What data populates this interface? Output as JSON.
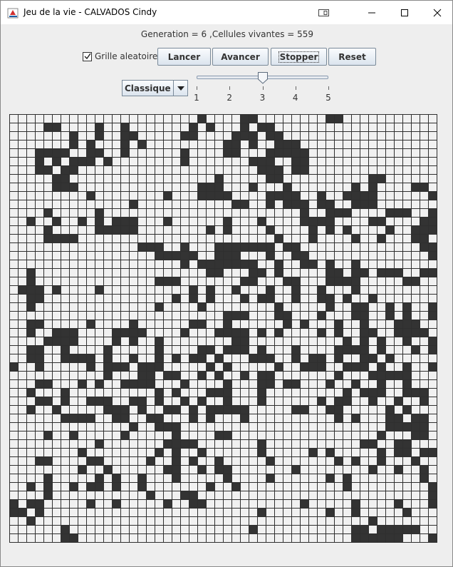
{
  "window": {
    "title": "Jeu de la vie - CALVADOS Cindy",
    "app_icon": "java-cup-icon",
    "controls": [
      "restore-extra-icon",
      "minimize-icon",
      "maximize-icon",
      "close-icon"
    ]
  },
  "status_text": "Generation = 6 ,Cellules vivantes = 559",
  "controls": {
    "checkbox_label": "Grille aleatoire",
    "checkbox_checked": true,
    "buttons": {
      "lancer": "Lancer",
      "avancer": "Avancer",
      "stopper": "Stopper",
      "reset": "Reset"
    },
    "mode_select_value": "Classique",
    "speed_slider": {
      "min": 1,
      "max": 5,
      "value": 3,
      "tick_labels": [
        "1",
        "2",
        "3",
        "4",
        "5"
      ]
    }
  },
  "colors": {
    "alive": "#333333",
    "dead": "#f1f1f1",
    "grid_line": "#2f2f2f"
  },
  "grid": {
    "rows": 50,
    "cols": 50,
    "cells": [
      "......................*....**........**...........",
      "....**....*..*.......*.*...*.**...................",
      ".......*..*..**.....**....***.**..................",
      ".......*.*...*.*.........**.*..***................",
      "...****..**..*......*....**...*****...............",
      "...*.*.***.*........*.......***..**...............",
      "...**.**.....................***.**...............",
      ".....**.................*.....**..........**......",
      ".....***..............***...*...*.......*.*....**.",
      ".........*........*...****....****..*..****......*",
      "..............*...........**..*.***.**..***.......",
      "....*.....*.......................*..***....***..*",
      "..*..*..*.*.***...*......*...*....****....**....**",
      "....*.....*****........*.*....*....*.*.*....*..***",
      "....****.......................*...*....*..*...**.",
      "...............***..*...*******.**..............**",
      ".................*****..***...*..**..............**",
      "....................*.*******..*..**.*..*.........",
      "..*....................**...**.*.....**.**.***..***",
      "..*..............***.......**...**...****.....**..",
      ".***.*....*..........*.*..*...*..*..*...*.........",
      "..**...............*.*.*...*.**..*..**.*..*.......",
      "..*..............*....*........*.....*..**..*.*..*",
      ".........................***...**...*...**..*.*..*",
      "..**.....*....*......**..*......*.*...*..*...***..",
      "..*..***....****....*...****.*.*....*.*..**..****.",
      "....****....*.*..*........**...........*.*.*..*..*",
      "..**..*....*.....*....**.***.*...*....****.*...*.*",
      "..**..****.*..*..*.*.**.*...***..*.**.*..**.*.....",
      "*..*.....*.***.***.....*.*.....*..***..***.*..*..*",
      "...........*...**.**..*.*..*.**.......*...*****...",
      "...**...*.*..****...*....*...**.**...*..*..*..*...",
      "..*...*..........*.*...***...*.........*.***..***.",
      "...**.*..***..**.*..*.*..*...*......*.**..*..*..*.",
      "..*..*.....***.*..**.*.*****.....**..**.....*.*...",
      "......****..**..**...*.*...*..........*.*...**.**.",
      "..............*..***........................*****..",
      "....*..*.....*.....*....**.................*...**.",
      "..........*.......****.......*...........**..**...",
      "........*........*.*..*......*.....*.*.....*.**.**",
      "...**....**.....*..*.*..*.....*.......*.*..*...*..",
      "........*..*......**..*.**.......*........*..*..*.",
      "....*.....*.*..*...*.....*....*......*.*........*.",
      "..*.*..*.**.*..*.......*..*............*.........*",
      "....*...........*...**...........................*",
      "*.**.....*..*.....*..**...........*.....*....*...*",
      "**.*.........................*.......*..*.....*...",
      "..*.......................................*.......*",
      "......*.....................*...........**.*****..",
      "......**................................******...*"
    ]
  }
}
